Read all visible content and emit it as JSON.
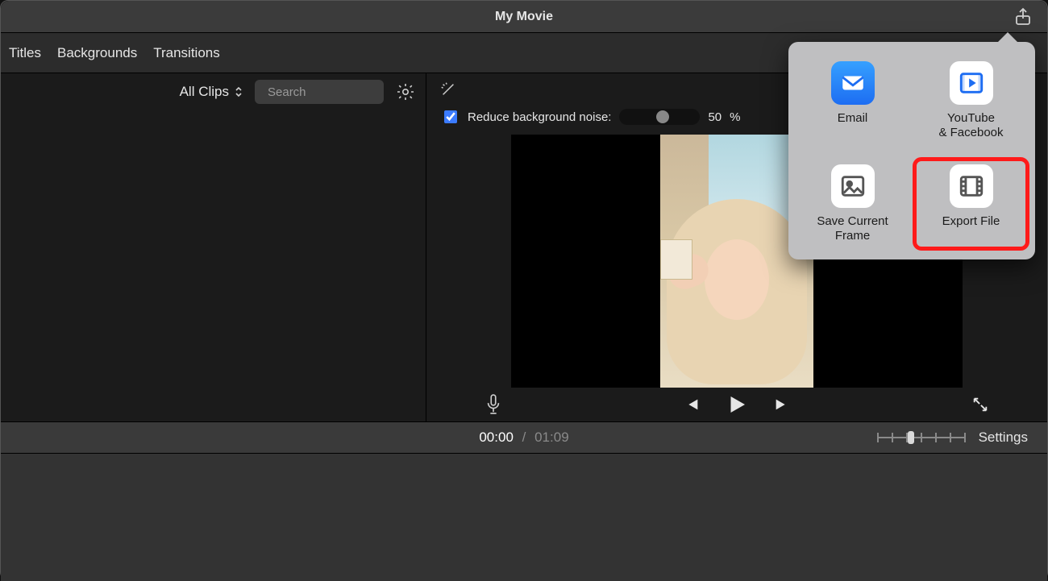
{
  "title": "My Movie",
  "tabs": {
    "titles": "Titles",
    "backgrounds": "Backgrounds",
    "transitions": "Transitions"
  },
  "browser": {
    "filter_label": "All Clips",
    "search_placeholder": "Search"
  },
  "inspector": {
    "noise_label": "Reduce background noise:",
    "noise_value": "50",
    "noise_unit": "%"
  },
  "playback": {
    "current": "00:00",
    "total": "01:09"
  },
  "timeline": {
    "settings_label": "Settings"
  },
  "share_popover": {
    "email": "Email",
    "youtube_facebook_line1": "YouTube",
    "youtube_facebook_line2": "& Facebook",
    "save_frame": "Save Current Frame",
    "export_file": "Export File"
  }
}
